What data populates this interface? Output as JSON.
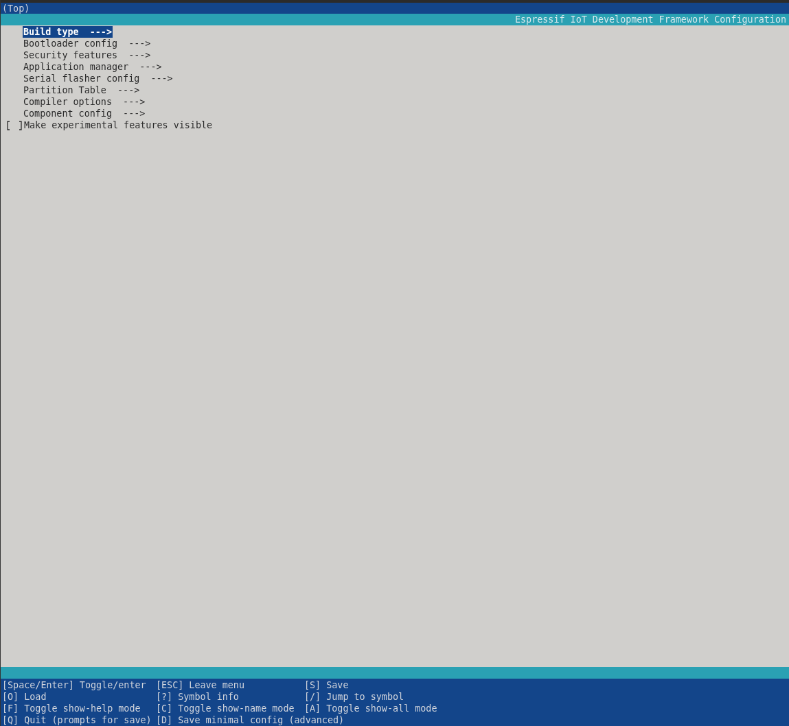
{
  "breadcrumb": "(Top)",
  "title": "Espressif IoT Development Framework Configuration",
  "menu": [
    {
      "kind": "submenu",
      "label": "Build type  --->",
      "selected": true
    },
    {
      "kind": "submenu",
      "label": "Bootloader config  --->",
      "selected": false
    },
    {
      "kind": "submenu",
      "label": "Security features  --->",
      "selected": false
    },
    {
      "kind": "submenu",
      "label": "Application manager  --->",
      "selected": false
    },
    {
      "kind": "submenu",
      "label": "Serial flasher config  --->",
      "selected": false
    },
    {
      "kind": "submenu",
      "label": "Partition Table  --->",
      "selected": false
    },
    {
      "kind": "submenu",
      "label": "Compiler options  --->",
      "selected": false
    },
    {
      "kind": "submenu",
      "label": "Component config  --->",
      "selected": false
    },
    {
      "kind": "checkbox",
      "label": "Make experimental features visible",
      "checked": false,
      "selected": false
    }
  ],
  "help": [
    [
      "[Space/Enter] Toggle/enter",
      "[ESC] Leave menu",
      "[S] Save"
    ],
    [
      "[O] Load",
      "[?] Symbol info",
      "[/] Jump to symbol"
    ],
    [
      "[F] Toggle show-help mode",
      "[C] Toggle show-name mode",
      "[A] Toggle show-all mode"
    ],
    [
      "[Q] Quit (prompts for save)",
      "[D] Save minimal config (advanced)"
    ]
  ]
}
